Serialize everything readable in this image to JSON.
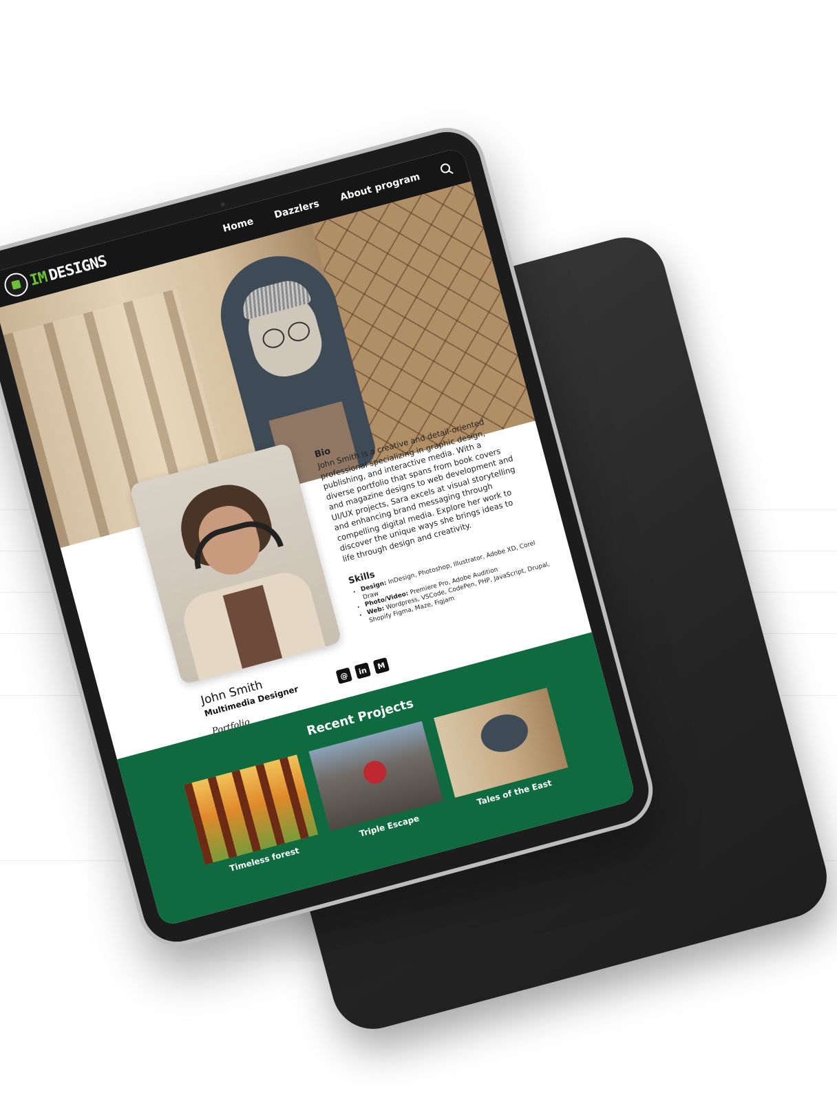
{
  "header": {
    "logo_prefix": "IM",
    "logo_text": "DESIGNS",
    "nav": [
      "Home",
      "Dazzlers",
      "About program"
    ]
  },
  "profile": {
    "bio_title": "Bio",
    "bio_text": "John Smith is a creative and detail-oriented professional specializing in graphic design, publishing, and interactive media. With a diverse portfolio that spans from book covers and magazine designs to web development and UI/UX projects, Sara excels at visual storytelling and enhancing brand messaging through compelling digital media. Explore her work to discover the unique ways she brings ideas to life through design and creativity.",
    "skills_title": "Skills",
    "skills": [
      {
        "label": "Design:",
        "value": "InDesign, Photoshop, Illustrator, Adobe XD, Corel Draw"
      },
      {
        "label": "Photo/Video:",
        "value": "Premiere Pro, Adobe Audition"
      },
      {
        "label": "Web:",
        "value": "Wordpress, VSCode, CodePen, PHP, JavaScript, Drupal, Shopify Figma, Maze, Figjam"
      }
    ],
    "name": "John Smith",
    "role": "Multimedia Designer",
    "portfolio_link": "Portfolio",
    "socials": [
      "@",
      "in",
      "M"
    ]
  },
  "projects": {
    "title": "Recent Projects",
    "items": [
      {
        "label": "Timeless forest"
      },
      {
        "label": "Triple Escape"
      },
      {
        "label": "Tales of the East"
      }
    ]
  },
  "colors": {
    "accent_green": "#0f6b3f",
    "logo_green": "#6fbf3a",
    "header_bg": "#161616"
  }
}
